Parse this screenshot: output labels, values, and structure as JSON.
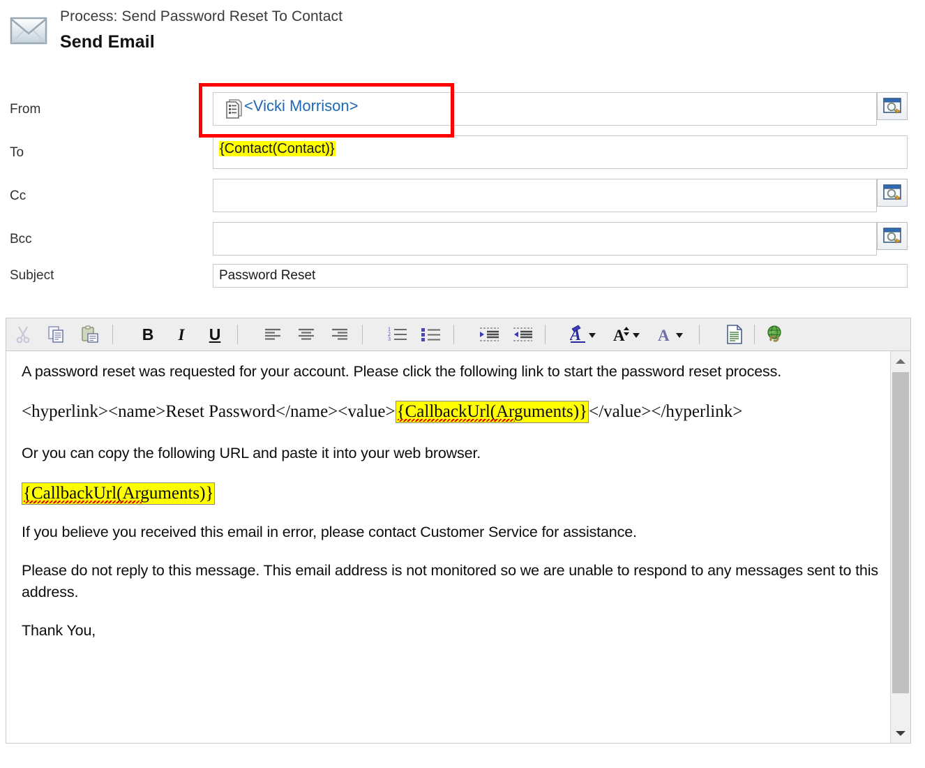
{
  "header": {
    "icon": "envelope-icon",
    "process_label": "Process: Send Password Reset To Contact",
    "title": "Send Email"
  },
  "form": {
    "rows": [
      {
        "label": "From",
        "value": "<Vicki Morrison>",
        "icon": "record-lookup-icon",
        "has_lookup_button": true,
        "highlighted": false,
        "annotated": true
      },
      {
        "label": "To",
        "value": "{Contact(Contact)}",
        "icon": "",
        "has_lookup_button": false,
        "highlighted": true,
        "annotated": false
      },
      {
        "label": "Cc",
        "value": "",
        "icon": "",
        "has_lookup_button": true,
        "highlighted": false,
        "annotated": false
      },
      {
        "label": "Bcc",
        "value": "",
        "icon": "",
        "has_lookup_button": true,
        "highlighted": false,
        "annotated": false
      }
    ],
    "subject": {
      "label": "Subject",
      "value": "Password Reset"
    }
  },
  "toolbar": {
    "items": [
      {
        "name": "cut-icon",
        "label": "",
        "kind": "icon",
        "disabled": true
      },
      {
        "name": "copy-icon",
        "label": "",
        "kind": "icon",
        "disabled": false
      },
      {
        "name": "paste-icon",
        "label": "",
        "kind": "icon",
        "disabled": false
      },
      {
        "name": "bold-button",
        "label": "B",
        "kind": "text",
        "disabled": false
      },
      {
        "name": "italic-button",
        "label": "I",
        "kind": "text",
        "disabled": false
      },
      {
        "name": "underline-button",
        "label": "U",
        "kind": "text",
        "disabled": false
      },
      {
        "name": "align-left-icon",
        "label": "",
        "kind": "icon",
        "disabled": false
      },
      {
        "name": "align-center-icon",
        "label": "",
        "kind": "icon",
        "disabled": false
      },
      {
        "name": "align-right-icon",
        "label": "",
        "kind": "icon",
        "disabled": false
      },
      {
        "name": "numbered-list-icon",
        "label": "",
        "kind": "icon",
        "disabled": false
      },
      {
        "name": "bulleted-list-icon",
        "label": "",
        "kind": "icon",
        "disabled": false
      },
      {
        "name": "increase-indent-icon",
        "label": "",
        "kind": "icon",
        "disabled": false
      },
      {
        "name": "decrease-indent-icon",
        "label": "",
        "kind": "icon",
        "disabled": false
      },
      {
        "name": "font-family-icon",
        "label": "",
        "kind": "icon",
        "disabled": false
      },
      {
        "name": "font-size-icon",
        "label": "",
        "kind": "icon",
        "disabled": false
      },
      {
        "name": "font-color-icon",
        "label": "",
        "kind": "icon",
        "disabled": false
      },
      {
        "name": "source-view-icon",
        "label": "",
        "kind": "icon",
        "disabled": false
      },
      {
        "name": "insert-hyperlink-icon",
        "label": "",
        "kind": "icon",
        "disabled": false
      }
    ]
  },
  "body": {
    "paragraph_1": "A password reset was requested for your account. Please click the following link to start the password reset process.",
    "hyperlink_prefix": "<hyperlink><name>Reset Password</name><value>",
    "hyperlink_token": "{CallbackUrl(Arguments)}",
    "hyperlink_suffix": "</value></hyperlink>",
    "paragraph_2": "Or you can copy the following URL and paste it into your web browser.",
    "standalone_token": "{CallbackUrl(Arguments)}",
    "paragraph_3": "If you believe you received this email in error, please contact Customer Service for assistance.",
    "paragraph_4": "Please do not reply to this message. This email address is not monitored so we are unable to respond to any messages sent to this address.",
    "paragraph_5": "Thank You,"
  },
  "colors": {
    "highlight_yellow": "#ffff00",
    "annotation_red": "#fe0000",
    "link_blue": "#1d68b3",
    "toolbar_bg": "#eeeeee",
    "spellcheck_red": "#e00000"
  }
}
